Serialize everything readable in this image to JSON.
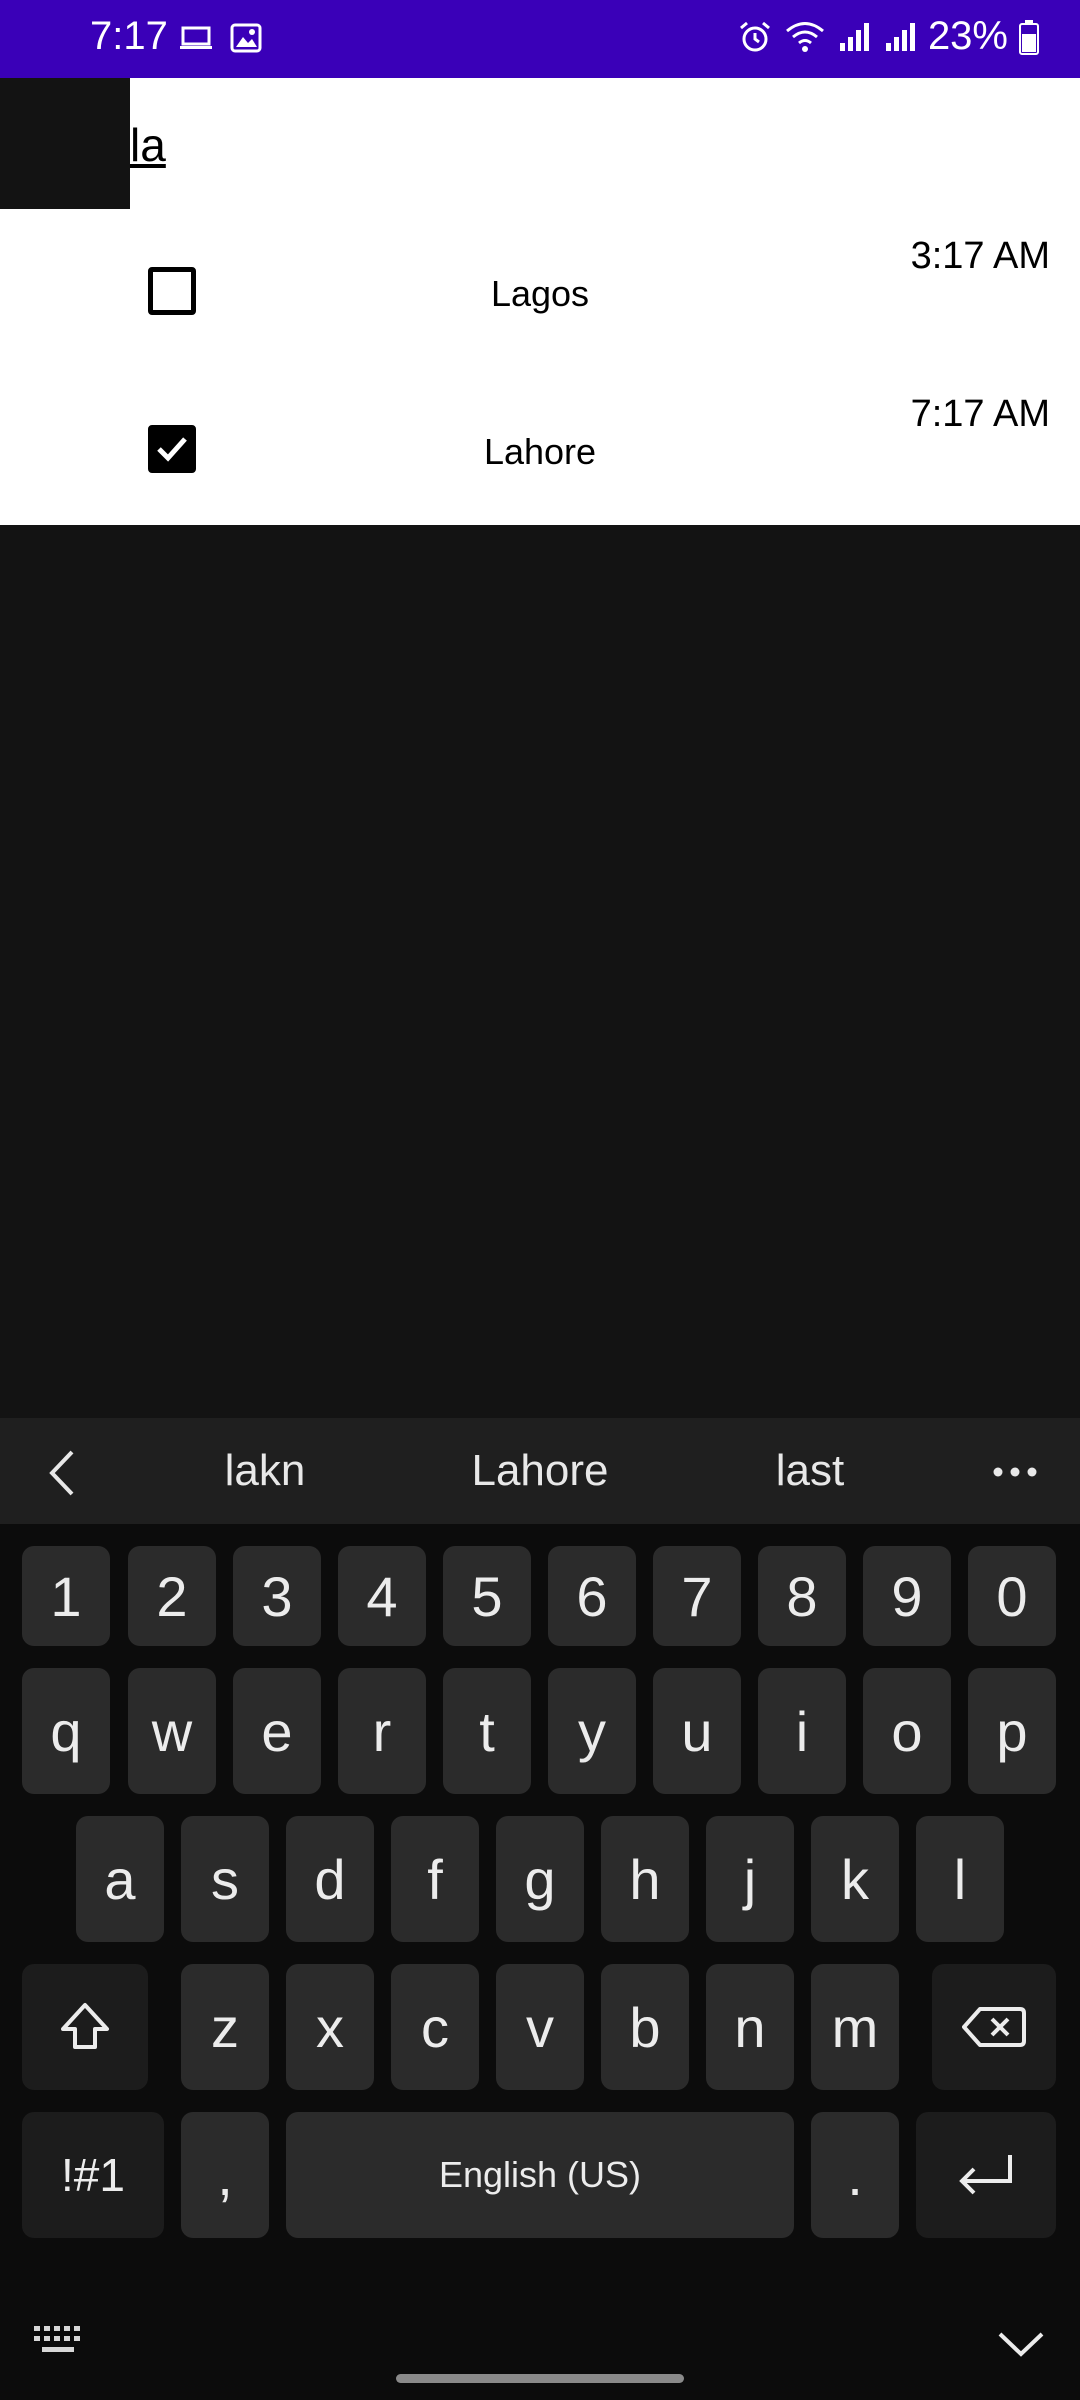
{
  "status_bar": {
    "time": "7:17",
    "battery_percent": "23%"
  },
  "search": {
    "query": "la"
  },
  "results": [
    {
      "city": "Lagos",
      "time": "3:17 AM",
      "checked": false
    },
    {
      "city": "Lahore",
      "time": "7:17 AM",
      "checked": true
    }
  ],
  "suggestions": [
    "lakn",
    "Lahore",
    "last"
  ],
  "keyboard": {
    "row_numbers": [
      "1",
      "2",
      "3",
      "4",
      "5",
      "6",
      "7",
      "8",
      "9",
      "0"
    ],
    "row_q": [
      "q",
      "w",
      "e",
      "r",
      "t",
      "y",
      "u",
      "i",
      "o",
      "p"
    ],
    "row_a": [
      "a",
      "s",
      "d",
      "f",
      "g",
      "h",
      "j",
      "k",
      "l"
    ],
    "row_z": [
      "z",
      "x",
      "c",
      "v",
      "b",
      "n",
      "m"
    ],
    "symbols_label": "!#1",
    "comma_label": ",",
    "space_label": "English (US)",
    "period_label": "."
  },
  "colors": {
    "status_bar": "#3a00b8",
    "background": "#131313",
    "key": "#2b2b2b"
  }
}
